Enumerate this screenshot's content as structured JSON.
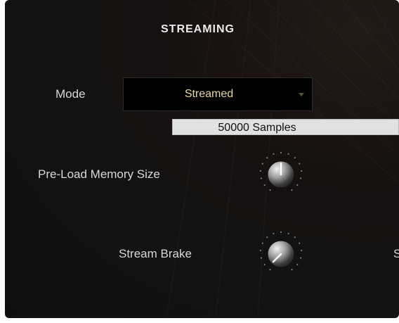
{
  "section": {
    "title": "STREAMING"
  },
  "mode": {
    "label": "Mode",
    "value": "Streamed",
    "icon": "chevron-down-icon"
  },
  "preload_value": {
    "text": "50000 Samples"
  },
  "preload": {
    "label": "Pre-Load Memory Size",
    "level": 0.5,
    "icon": "knob-icon"
  },
  "brake": {
    "label": "Stream Brake",
    "level": 0.0,
    "icon": "knob-icon"
  },
  "right_cut": {
    "label": "S"
  },
  "colors": {
    "panel_bg": "#121212",
    "label_text": "#d8d8d8",
    "accent_value": "#e8d79a",
    "value_box_bg": "#e1e1e1"
  }
}
